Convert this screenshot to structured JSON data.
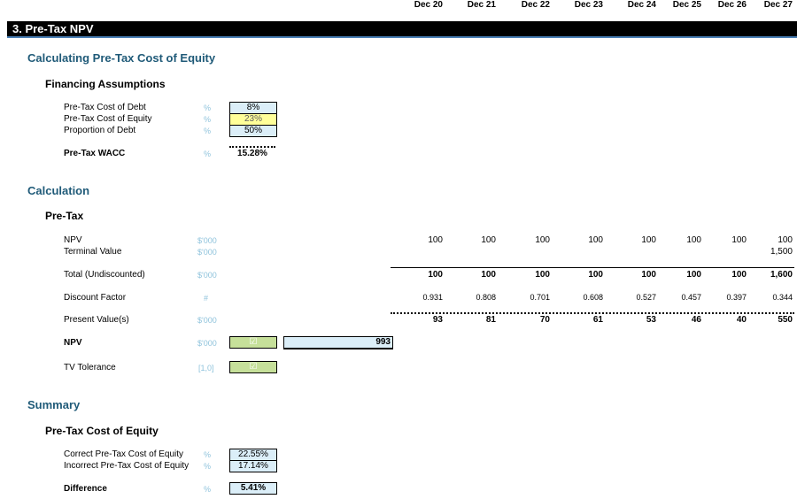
{
  "timeline": [
    "Dec 20",
    "Dec 21",
    "Dec 22",
    "Dec 23",
    "Dec 24",
    "Dec 25",
    "Dec 26",
    "Dec 27"
  ],
  "section_title": "3. Pre-Tax NPV",
  "calc_pre_tax_heading": "Calculating Pre-Tax Cost of Equity",
  "financing": {
    "heading": "Financing Assumptions",
    "rows": [
      {
        "label": "Pre-Tax Cost of Debt",
        "unit": "%",
        "value": "8%"
      },
      {
        "label": "Pre-Tax Cost of Equity",
        "unit": "%",
        "value": "23%"
      },
      {
        "label": "Proportion of Debt",
        "unit": "%",
        "value": "50%"
      }
    ],
    "wacc_label": "Pre-Tax WACC",
    "wacc_unit": "%",
    "wacc_value": "15.28%"
  },
  "calculation": {
    "heading": "Calculation",
    "subheading": "Pre-Tax",
    "npv_row": {
      "label": "NPV",
      "unit": "$'000",
      "values": [
        "100",
        "100",
        "100",
        "100",
        "100",
        "100",
        "100",
        "100"
      ]
    },
    "tv_row": {
      "label": "Terminal Value",
      "unit": "$'000",
      "values": [
        "",
        "",
        "",
        "",
        "",
        "",
        "",
        "1,500"
      ]
    },
    "total_row": {
      "label": "Total (Undiscounted)",
      "unit": "$'000",
      "values": [
        "100",
        "100",
        "100",
        "100",
        "100",
        "100",
        "100",
        "1,600"
      ]
    },
    "df_row": {
      "label": "Discount Factor",
      "unit": "#",
      "values": [
        "0.931",
        "0.808",
        "0.701",
        "0.608",
        "0.527",
        "0.457",
        "0.397",
        "0.344"
      ]
    },
    "pv_row": {
      "label": "Present Value(s)",
      "unit": "$'000",
      "values": [
        "93",
        "81",
        "70",
        "61",
        "53",
        "46",
        "40",
        "550"
      ]
    },
    "npv_total": {
      "label": "NPV",
      "unit": "$'000",
      "check": "☑",
      "value": "993"
    },
    "tv_tol": {
      "label": "TV Tolerance",
      "unit": "[1,0]",
      "check": "☑"
    }
  },
  "summary": {
    "heading": "Summary",
    "subheading": "Pre-Tax Cost of Equity",
    "rows": [
      {
        "label": "Correct Pre-Tax Cost of Equity",
        "unit": "%",
        "value": "22.55%"
      },
      {
        "label": "Incorrect Pre-Tax Cost of Equity",
        "unit": "%",
        "value": "17.14%"
      }
    ],
    "diff_label": "Difference",
    "diff_unit": "%",
    "diff_value": "5.41%"
  },
  "colors": {
    "heading": "#1f5a78",
    "input_blue": "#dbeef8",
    "input_yellow": "#ffff99",
    "check_green": "#c6e09a",
    "banner": "#000000"
  }
}
